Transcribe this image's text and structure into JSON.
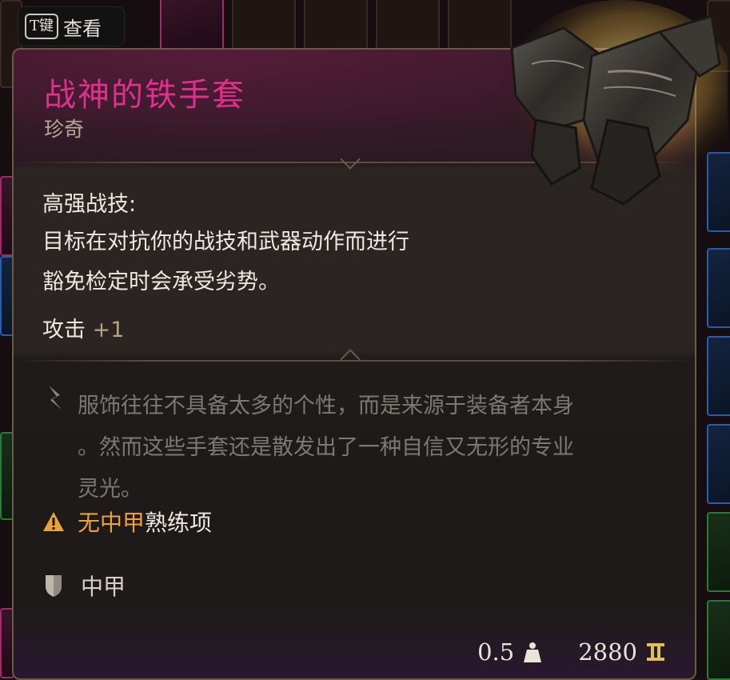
{
  "key_hint": {
    "key": "T键",
    "action": "查看"
  },
  "item": {
    "name": "战神的铁手套",
    "rarity": "珍奇",
    "passive_title": "高强战技:",
    "passive_desc_line1": "目标在对抗你的战技和武器动作而进行",
    "passive_desc_line2": "豁免检定时会承受劣势。",
    "stat_label": "攻击",
    "stat_value": "+1",
    "lore_line1": "服饰往往不具备太多的个性，而是来源于装备者本身",
    "lore_line2": "。然而这些手套还是散发出了一种自信又无形的专业",
    "lore_line3": "灵光。",
    "proficiency_warning_highlight": "无中甲",
    "proficiency_warning_rest": "熟练项",
    "armor_type": "中甲",
    "weight": "0.5",
    "value": "2880"
  },
  "icons": {
    "lore": "quill-icon",
    "warning": "warning-icon",
    "armor": "shield-icon",
    "weight": "weight-icon",
    "gold": "gold-coin-icon"
  },
  "colors": {
    "rarity_name": "#e0308e",
    "warning": "#e8a23a",
    "stat_bonus": "#b9a37f"
  }
}
